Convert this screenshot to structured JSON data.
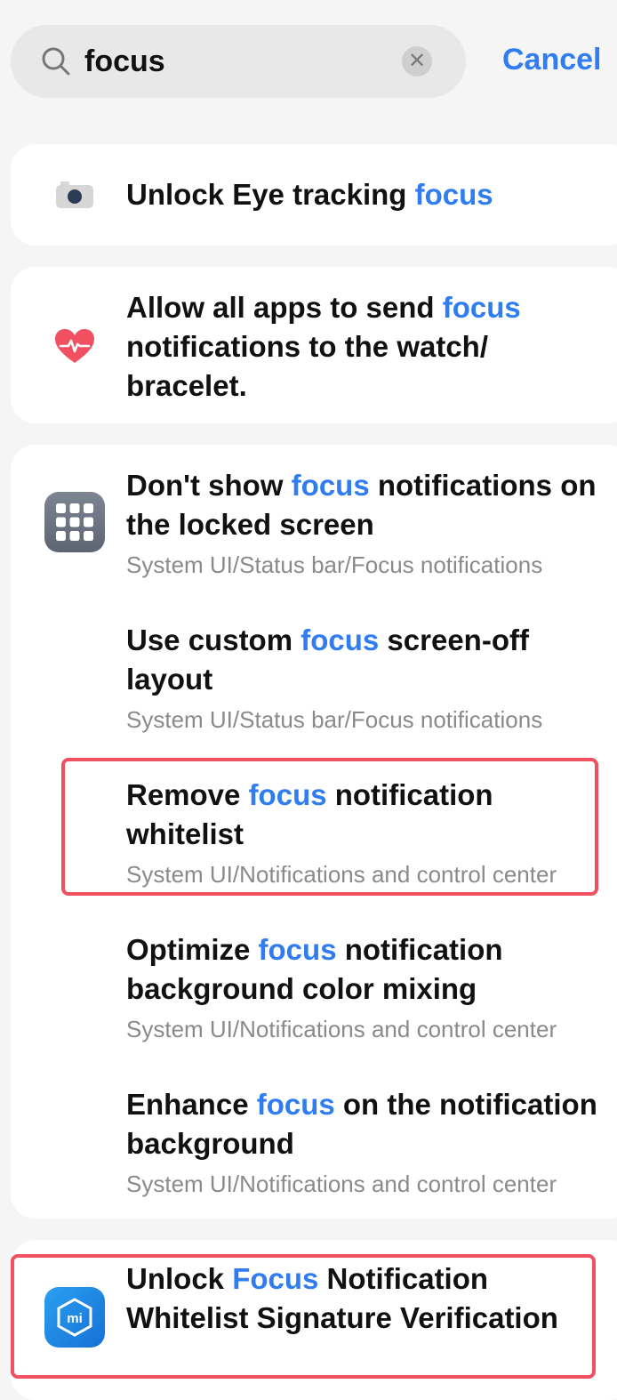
{
  "search": {
    "query": "focus",
    "cancel_label": "Cancel"
  },
  "results": {
    "r1": {
      "pre": "Unlock Eye tracking ",
      "hl": "focus",
      "post": ""
    },
    "r2": {
      "pre": "Allow all apps to send ",
      "hl": "focus",
      "post": " notifications to the watch/ bracelet."
    },
    "r3": {
      "pre": "Don't show ",
      "hl": "focus",
      "post": " notifications on the locked screen",
      "path": "System UI/Status bar/Focus notifications"
    },
    "r4": {
      "pre": "Use custom ",
      "hl": "focus",
      "post": " screen-off layout",
      "path": "System UI/Status bar/Focus notifications"
    },
    "r5": {
      "pre": "Remove ",
      "hl": "focus",
      "post": " notification whitelist",
      "path": "System UI/Notifications and control center"
    },
    "r6": {
      "pre": "Optimize ",
      "hl": "focus",
      "post": " notification background color mixing",
      "path": "System UI/Notifications and control center"
    },
    "r7": {
      "pre": "Enhance ",
      "hl": "focus",
      "post": " on the notification background",
      "path": "System UI/Notifications and control center"
    },
    "r8": {
      "pre": "Unlock ",
      "hl": "Focus",
      "post": " Notification Whitelist Signature Verification"
    }
  },
  "colors": {
    "accent": "#2f7df0",
    "highlight_border": "#f0505f",
    "heart": "#f0505f",
    "mi_blue": "#1e88e5"
  },
  "icons": [
    "search-icon",
    "clear-icon",
    "camera-icon",
    "heart-rate-icon",
    "apps-grid-icon",
    "mi-icon"
  ]
}
